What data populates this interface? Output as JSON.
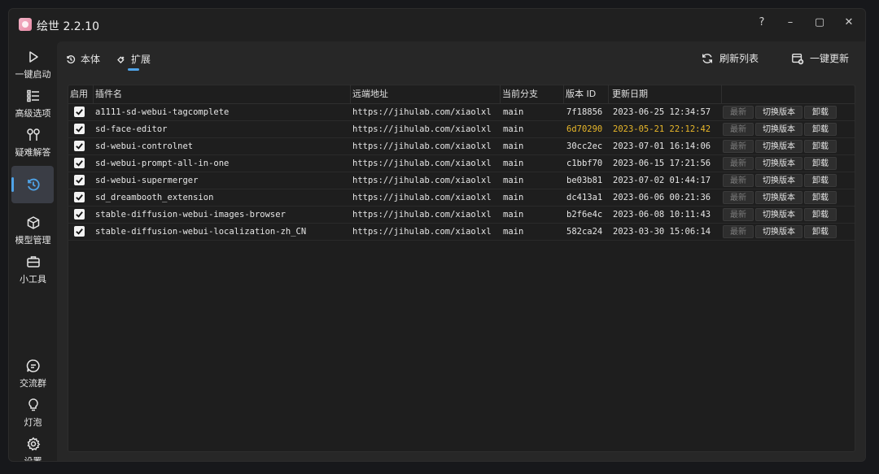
{
  "app": {
    "title": "绘世 2.2.10"
  },
  "window_controls": {
    "help": "?",
    "minimize": "–",
    "maximize": "▢",
    "close": "✕"
  },
  "sidebar": {
    "top": [
      {
        "id": "launch",
        "label": "一键启动",
        "icon": "play-icon"
      },
      {
        "id": "advanced",
        "label": "高级选项",
        "icon": "list-icon"
      },
      {
        "id": "troubleshoot",
        "label": "疑难解答",
        "icon": "wrench-icon"
      },
      {
        "id": "history",
        "label": "",
        "icon": "history-icon",
        "active": true
      },
      {
        "id": "models",
        "label": "模型管理",
        "icon": "cube-icon"
      },
      {
        "id": "tools",
        "label": "小工具",
        "icon": "toolbox-icon"
      }
    ],
    "bottom": [
      {
        "id": "chat",
        "label": "交流群",
        "icon": "chat-icon"
      },
      {
        "id": "bulb",
        "label": "灯泡",
        "icon": "bulb-icon"
      },
      {
        "id": "settings",
        "label": "设置",
        "icon": "gear-icon"
      }
    ]
  },
  "tabs": [
    {
      "label": "本体",
      "icon": "history-icon"
    },
    {
      "label": "扩展",
      "icon": "puzzle-icon",
      "active": true
    }
  ],
  "toolbar": {
    "refresh_label": "刷新列表",
    "update_all_label": "一键更新"
  },
  "table": {
    "headers": [
      "启用",
      "插件名",
      "远端地址",
      "当前分支",
      "版本 ID",
      "更新日期"
    ],
    "rows": [
      {
        "enabled": true,
        "name": "a1111-sd-webui-tagcomplete",
        "remote": "https://jihulab.com/xiaolxl",
        "branch": "main",
        "version": "7f18856",
        "date": "2023-06-25 12:34:57",
        "highlight": false
      },
      {
        "enabled": true,
        "name": "sd-face-editor",
        "remote": "https://jihulab.com/xiaolxl",
        "branch": "main",
        "version": "6d70290",
        "date": "2023-05-21 22:12:42",
        "highlight": true
      },
      {
        "enabled": true,
        "name": "sd-webui-controlnet",
        "remote": "https://jihulab.com/xiaolxl",
        "branch": "main",
        "version": "30cc2ec",
        "date": "2023-07-01 16:14:06",
        "highlight": false
      },
      {
        "enabled": true,
        "name": "sd-webui-prompt-all-in-one",
        "remote": "https://jihulab.com/xiaolxl",
        "branch": "main",
        "version": "c1bbf70",
        "date": "2023-06-15 17:21:56",
        "highlight": false
      },
      {
        "enabled": true,
        "name": "sd-webui-supermerger",
        "remote": "https://jihulab.com/xiaolxl",
        "branch": "main",
        "version": "be03b81",
        "date": "2023-07-02 01:44:17",
        "highlight": false
      },
      {
        "enabled": true,
        "name": "sd_dreambooth_extension",
        "remote": "https://jihulab.com/xiaolxl",
        "branch": "main",
        "version": "dc413a1",
        "date": "2023-06-06 00:21:36",
        "highlight": false
      },
      {
        "enabled": true,
        "name": "stable-diffusion-webui-images-browser",
        "remote": "https://jihulab.com/xiaolxl",
        "branch": "main",
        "version": "b2f6e4c",
        "date": "2023-06-08 10:11:43",
        "highlight": false
      },
      {
        "enabled": true,
        "name": "stable-diffusion-webui-localization-zh_CN",
        "remote": "https://jihulab.com/xiaolxl",
        "branch": "main",
        "version": "582ca24",
        "date": "2023-03-30 15:06:14",
        "highlight": false
      }
    ],
    "row_actions": {
      "latest": "最新",
      "switch": "切换版本",
      "uninstall": "卸载"
    }
  },
  "colors": {
    "accent": "#4fa3e8",
    "highlight_row_text": "#e8b72a",
    "background": "#202020"
  }
}
